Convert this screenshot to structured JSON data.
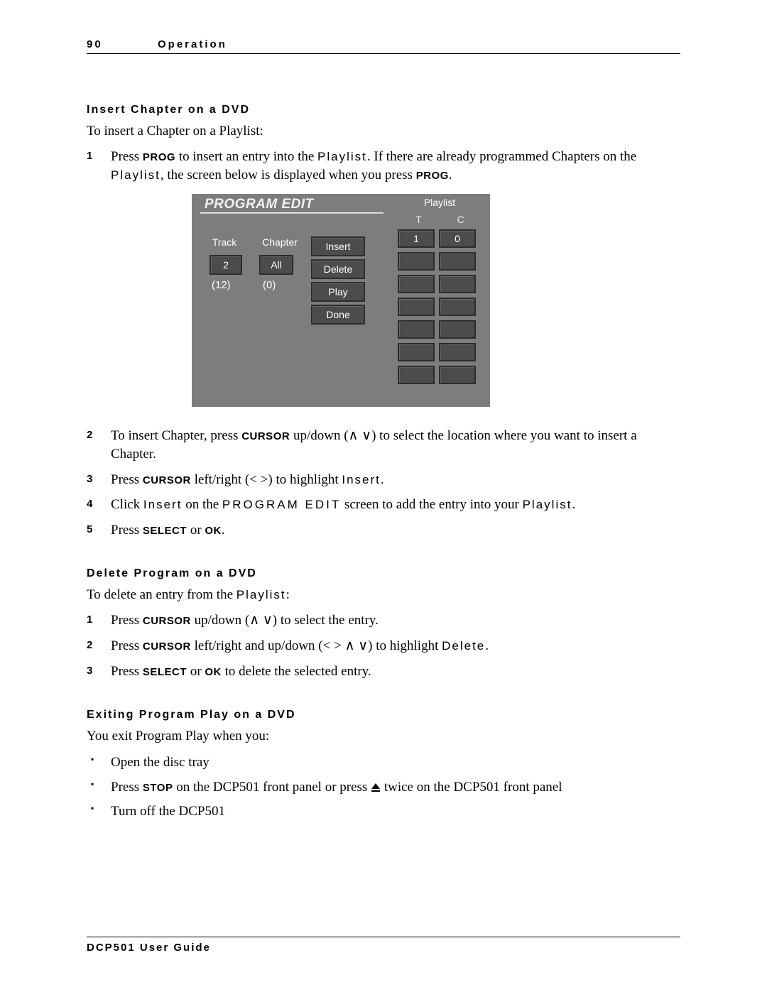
{
  "header": {
    "page_number": "90",
    "chapter": "Operation"
  },
  "sections": {
    "insert": {
      "heading": "Insert Chapter on a DVD",
      "intro": "To insert a Chapter on a Playlist:",
      "step1_a": "Press ",
      "step1_prog": "PROG",
      "step1_b": " to insert an entry into the ",
      "step1_playlist": "Playlist",
      "step1_c": ". If there are already programmed Chapters on the ",
      "step1_playlist2": "Playlist",
      "step1_d": ", the screen below is displayed when you press ",
      "step1_prog2": "PROG",
      "step1_e": ".",
      "step2_a": "To insert Chapter, press ",
      "step2_cursor": "CURSOR",
      "step2_b": " up/down (∧ ∨) to select the location where you want to insert a Chapter.",
      "step3_a": "Press ",
      "step3_cursor": "CURSOR",
      "step3_b": " left/right (< >) to highlight ",
      "step3_insert": "Insert",
      "step3_c": ".",
      "step4_a": "Click ",
      "step4_insert": "Insert",
      "step4_b": " on the ",
      "step4_screen": "PROGRAM EDIT",
      "step4_c": " screen to add the entry into your ",
      "step4_playlist": "Playlist",
      "step4_d": ".",
      "step5_a": "Press ",
      "step5_select": "SELECT",
      "step5_b": " or ",
      "step5_ok": "OK",
      "step5_c": "."
    },
    "delete": {
      "heading": "Delete Program on a DVD",
      "intro_a": "To delete an entry from the ",
      "intro_playlist": "Playlist",
      "intro_b": ":",
      "step1_a": "Press ",
      "step1_cursor": "CURSOR",
      "step1_b": " up/down (∧ ∨) to select the entry.",
      "step2_a": "Press ",
      "step2_cursor": "CURSOR",
      "step2_b": " left/right and up/down (< > ∧ ∨) to highlight ",
      "step2_delete": "Delete",
      "step2_c": ".",
      "step3_a": "Press ",
      "step3_select": "SELECT",
      "step3_b": " or ",
      "step3_ok": "OK",
      "step3_c": " to delete the selected entry."
    },
    "exit": {
      "heading": "Exiting Program Play on a DVD",
      "intro": "You exit Program Play when you:",
      "b1": "Open the disc tray",
      "b2_a": "Press ",
      "b2_stop": "STOP",
      "b2_b": " on the DCP501 front panel or press ",
      "b2_c": " twice on the DCP501 front panel",
      "b3": "Turn off the DCP501"
    }
  },
  "screen": {
    "title": "PROGRAM EDIT",
    "playlist_label": "Playlist",
    "col_t": "T",
    "col_c": "C",
    "track_label": "Track",
    "chapter_label": "Chapter",
    "track_value": "2",
    "chapter_value": "All",
    "track_total": "(12)",
    "chapter_total": "(0)",
    "btn_insert": "Insert",
    "btn_delete": "Delete",
    "btn_play": "Play",
    "btn_done": "Done",
    "playlist_rows": [
      {
        "t": "1",
        "c": "0"
      },
      {
        "t": "",
        "c": ""
      },
      {
        "t": "",
        "c": ""
      },
      {
        "t": "",
        "c": ""
      },
      {
        "t": "",
        "c": ""
      },
      {
        "t": "",
        "c": ""
      },
      {
        "t": "",
        "c": ""
      }
    ]
  },
  "footer": "DCP501 User Guide"
}
